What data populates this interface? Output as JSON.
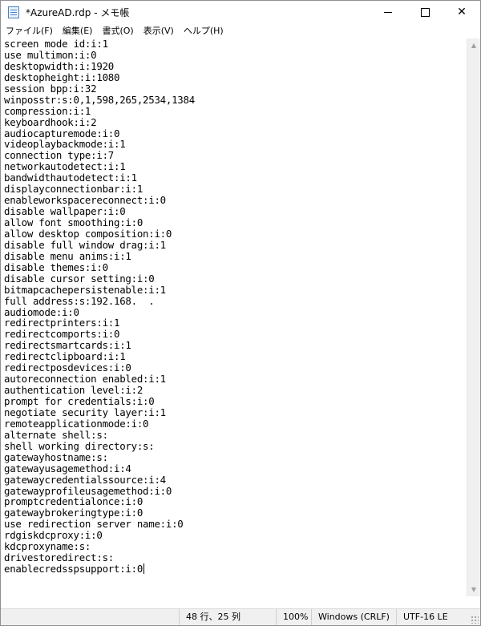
{
  "window": {
    "title": "*AzureAD.rdp - メモ帳",
    "minimize_glyph": "—",
    "maximize_glyph": "☐",
    "close_glyph": "✕"
  },
  "menu": [
    {
      "label": "ファイル(F)"
    },
    {
      "label": "編集(E)"
    },
    {
      "label": "書式(O)"
    },
    {
      "label": "表示(V)"
    },
    {
      "label": "ヘルプ(H)"
    }
  ],
  "editor": {
    "lines": [
      "screen mode id:i:1",
      "use multimon:i:0",
      "desktopwidth:i:1920",
      "desktopheight:i:1080",
      "session bpp:i:32",
      "winposstr:s:0,1,598,265,2534,1384",
      "compression:i:1",
      "keyboardhook:i:2",
      "audiocapturemode:i:0",
      "videoplaybackmode:i:1",
      "connection type:i:7",
      "networkautodetect:i:1",
      "bandwidthautodetect:i:1",
      "displayconnectionbar:i:1",
      "enableworkspacereconnect:i:0",
      "disable wallpaper:i:0",
      "allow font smoothing:i:0",
      "allow desktop composition:i:0",
      "disable full window drag:i:1",
      "disable menu anims:i:1",
      "disable themes:i:0",
      "disable cursor setting:i:0",
      "bitmapcachepersistenable:i:1",
      "full address:s:192.168.  .",
      "audiomode:i:0",
      "redirectprinters:i:1",
      "redirectcomports:i:0",
      "redirectsmartcards:i:1",
      "redirectclipboard:i:1",
      "redirectposdevices:i:0",
      "autoreconnection enabled:i:1",
      "authentication level:i:2",
      "prompt for credentials:i:0",
      "negotiate security layer:i:1",
      "remoteapplicationmode:i:0",
      "alternate shell:s:",
      "shell working directory:s:",
      "gatewayhostname:s:",
      "gatewayusagemethod:i:4",
      "gatewaycredentialssource:i:4",
      "gatewayprofileusagemethod:i:0",
      "promptcredentialonce:i:0",
      "gatewaybrokeringtype:i:0",
      "use redirection server name:i:0",
      "rdgiskdcproxy:i:0",
      "kdcproxyname:s:",
      "drivestoredirect:s:",
      "enablecredsspsupport:i:0"
    ]
  },
  "status": {
    "position": "48 行、25 列",
    "zoom": "100%",
    "line_ending": "Windows (CRLF)",
    "encoding": "UTF-16 LE"
  }
}
